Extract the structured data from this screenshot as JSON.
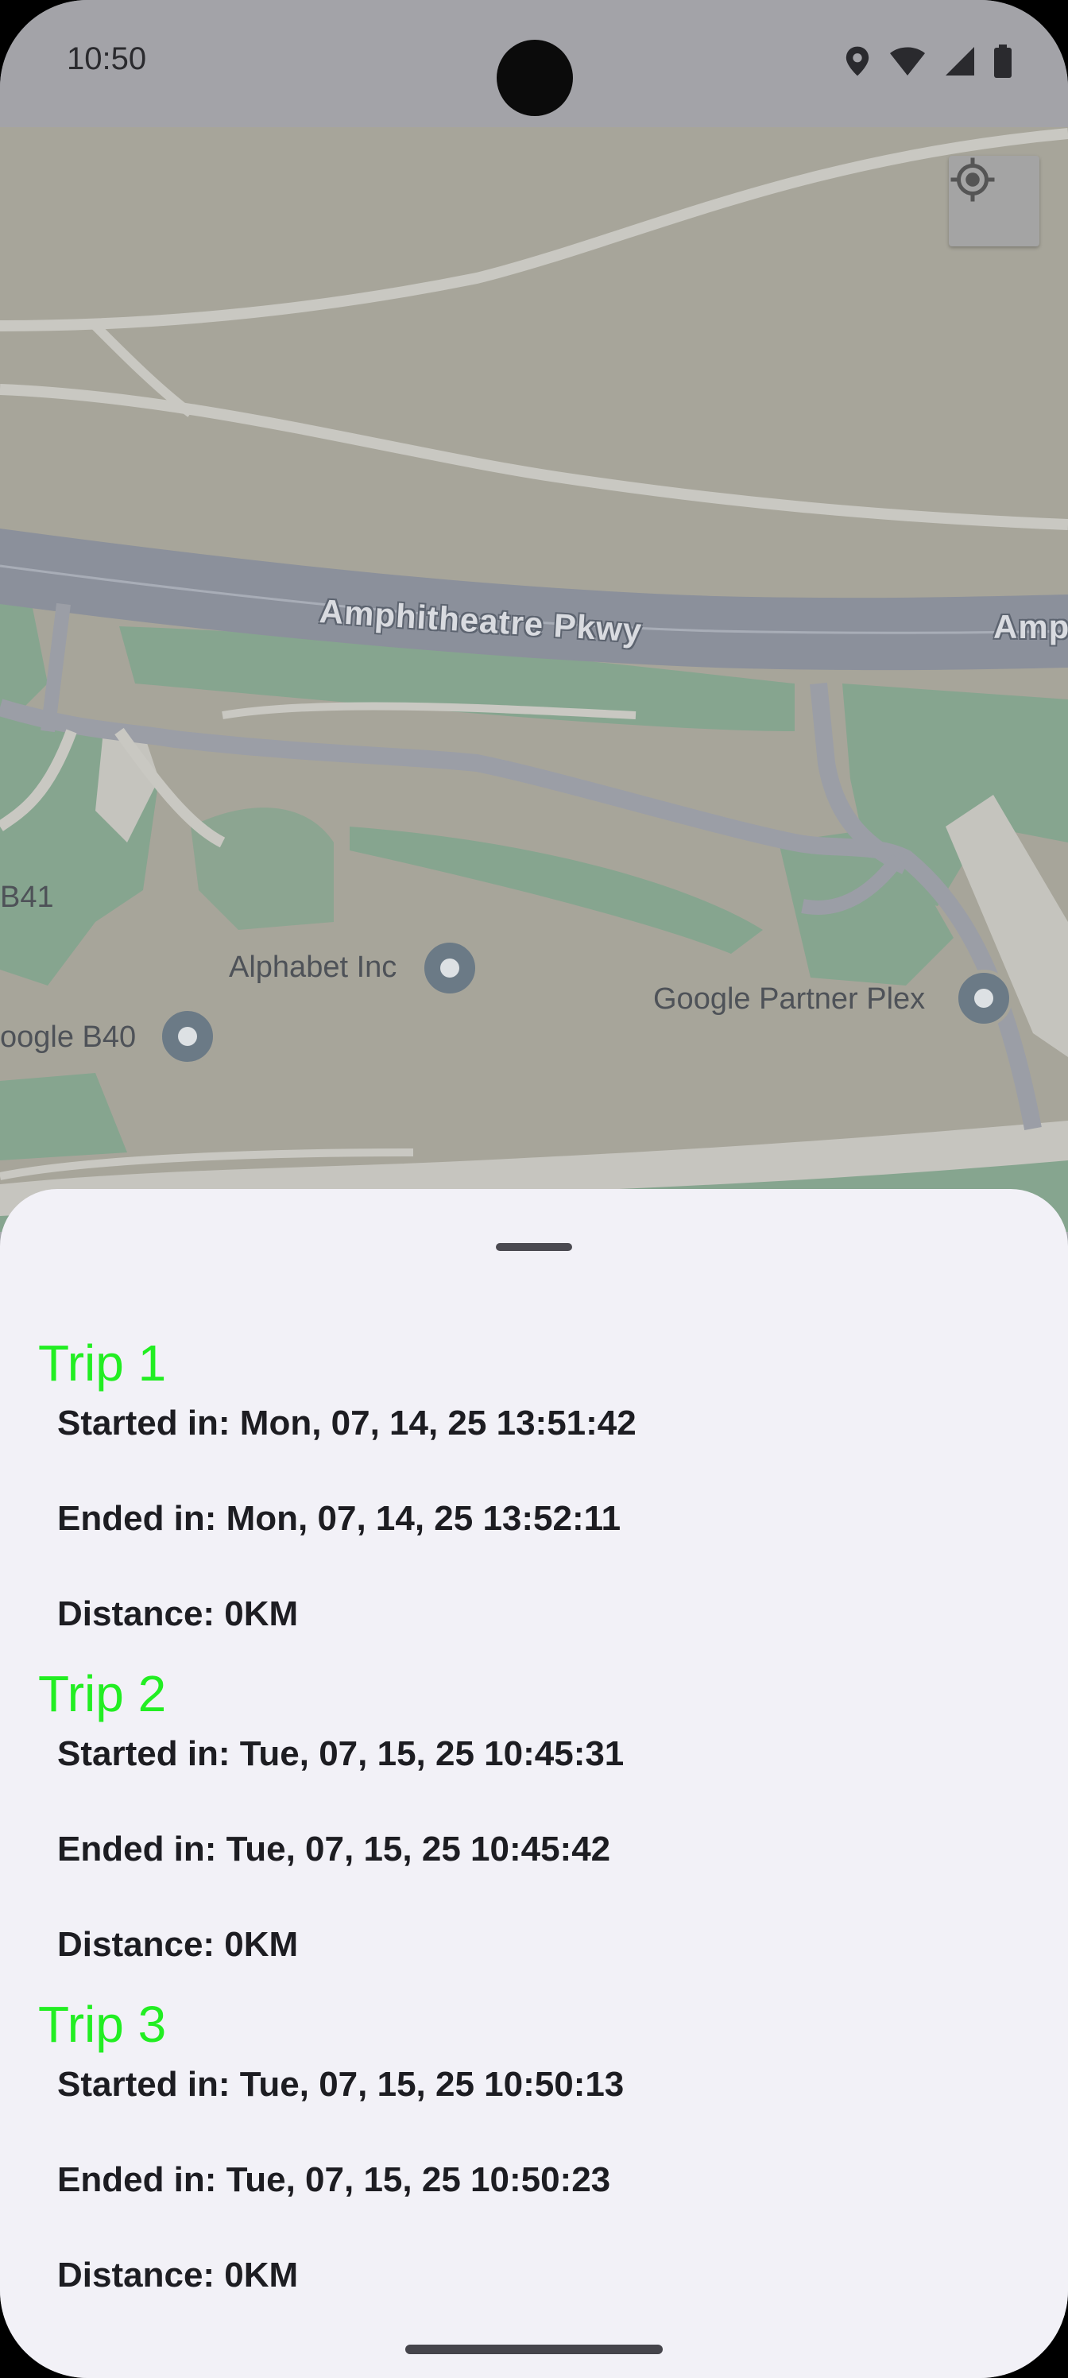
{
  "status_bar": {
    "time": "10:50",
    "icons": [
      "location-icon",
      "wifi-icon",
      "signal-icon",
      "battery-icon"
    ]
  },
  "map": {
    "road_label": "Amphitheatre Pkwy",
    "road_label_right": "Amp",
    "places": [
      {
        "name": "Alphabet Inc"
      },
      {
        "name": "Google Partner Plex"
      },
      {
        "name": "oogle B40"
      },
      {
        "name": "B41"
      }
    ],
    "locate_button_icon": "my-location-icon"
  },
  "sheet": {
    "trips": [
      {
        "title": "Trip 1",
        "started": "Started in: Mon, 07, 14, 25 13:51:42",
        "ended": "Ended in: Mon, 07, 14, 25 13:52:11",
        "distance": "Distance: 0KM"
      },
      {
        "title": "Trip 2",
        "started": "Started in: Tue, 07, 15, 25 10:45:31",
        "ended": "Ended in: Tue, 07, 15, 25 10:45:42",
        "distance": "Distance: 0KM"
      },
      {
        "title": "Trip 3",
        "started": "Started in: Tue, 07, 15, 25 10:50:13",
        "ended": "Ended in: Tue, 07, 15, 25 10:50:23",
        "distance": "Distance: 0KM"
      }
    ]
  },
  "colors": {
    "trip_title": "#22ee22",
    "sheet_background": "#f2f1f7",
    "map_land": "#a7a59a",
    "map_green": "#86a58f",
    "road": "#8b909b"
  }
}
